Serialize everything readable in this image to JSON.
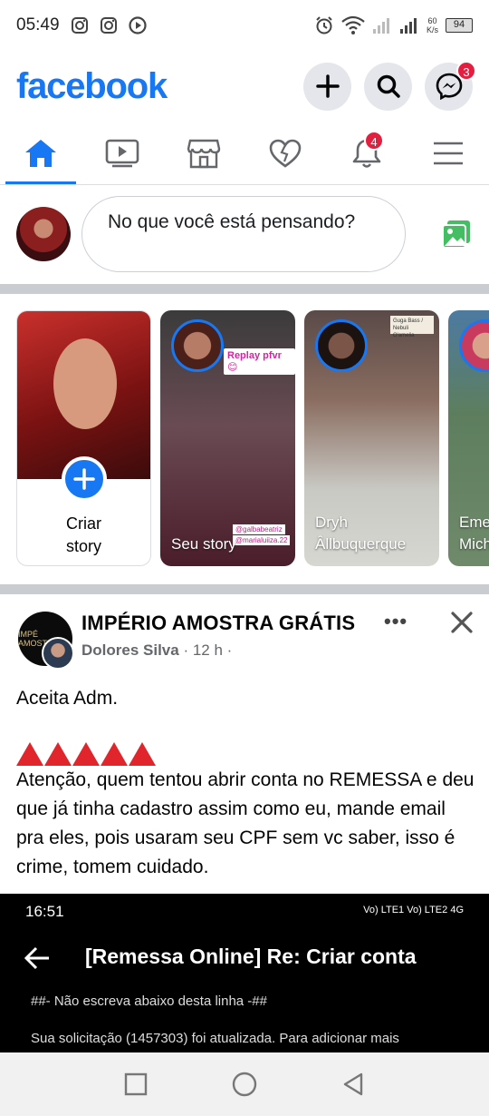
{
  "status_bar": {
    "time": "05:49",
    "icons_left": [
      "instagram-icon",
      "instagram-icon",
      "play-icon"
    ],
    "net_speed": "60",
    "net_unit": "K/s",
    "battery": "94"
  },
  "header": {
    "logo": "facebook",
    "messenger_badge": "3"
  },
  "nav": {
    "tabs": [
      "home-icon",
      "watch-icon",
      "marketplace-icon",
      "dating-icon",
      "bell-icon",
      "menu-icon"
    ],
    "notifications_badge": "4"
  },
  "composer": {
    "placeholder": "No que você está pensando?"
  },
  "stories": {
    "create_label_1": "Criar",
    "create_label_2": "story",
    "items": [
      {
        "name": "Seu story",
        "replay_tag": "Replay pfvr 😊",
        "mention_1": "@galbabeatriz",
        "mention_2": "@marialuiiza.22"
      },
      {
        "name_1": "Dryh",
        "name_2": "Âllbuquerque",
        "tag": "Guga Bass / Nebuli O'amelia"
      },
      {
        "name_1": "Eme",
        "name_2": "Mich"
      }
    ]
  },
  "post": {
    "page_name": "IMPÉRIO AMOSTRA GRÁTIS",
    "page_logo_text": "IMPÉ AMOSTR",
    "author": "Dolores Silva",
    "time": "· 12 h ·",
    "more": "•••",
    "text_1": "Aceita Adm.",
    "warning_count": 5,
    "text_2": "Atenção, quem tentou abrir conta no REMESSA e deu que já tinha cadastro assim como eu, mande email pra eles, pois usaram seu CPF sem vc saber, isso é crime, tomem cuidado."
  },
  "embedded": {
    "time": "16:51",
    "status_right": "Vo) LTE1 Vo) LTE2 4G",
    "title": "[Remessa Online] Re: Criar conta",
    "line1": "##- Não escreva abaixo desta linha -##",
    "line2": "Sua solicitação (1457303) foi atualizada. Para adicionar mais"
  },
  "colors": {
    "brand": "#1877f2",
    "badge": "#e41e3f",
    "warning": "#e0252c",
    "photo_icon": "#45bd62"
  }
}
